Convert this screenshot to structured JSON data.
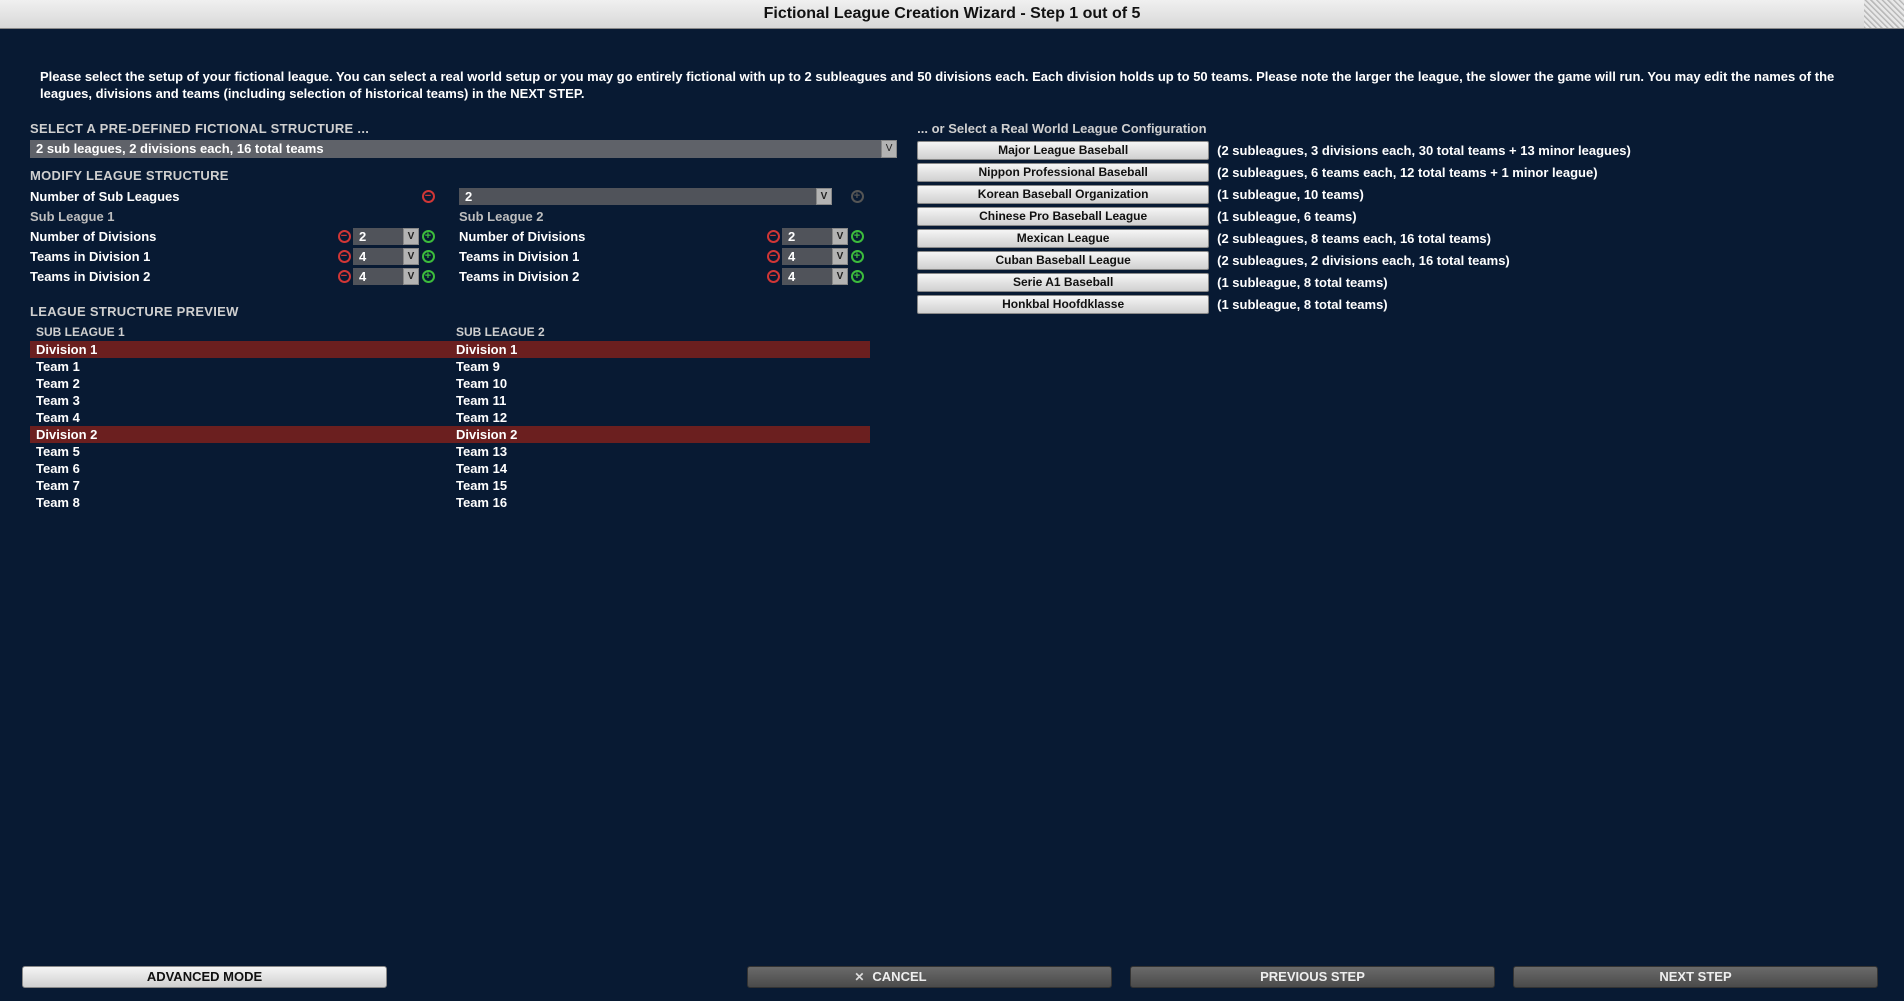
{
  "window": {
    "title": "Fictional League Creation Wizard - Step 1 out of 5"
  },
  "intro": "Please select the setup of your fictional league. You can select a real world setup or you may go entirely fictional with up to 2 subleagues and 50 divisions each. Each division holds up to 50 teams. Please note the larger the league, the slower the game will run. You may edit the names of the leagues, divisions and teams (including selection of historical teams) in the NEXT STEP.",
  "predef": {
    "header": "SELECT A PRE-DEFINED FICTIONAL STRUCTURE ...",
    "selected": "2 sub leagues, 2 divisions each, 16 total teams"
  },
  "modify": {
    "header": "MODIFY LEAGUE STRUCTURE",
    "numSubleaguesLabel": "Number of Sub Leagues",
    "numSubleagues": "2",
    "sl1": {
      "name": "Sub League 1",
      "numDivLabel": "Number of Divisions",
      "numDiv": "2",
      "td1Label": "Teams in Division 1",
      "td1": "4",
      "td2Label": "Teams in Division 2",
      "td2": "4"
    },
    "sl2": {
      "name": "Sub League 2",
      "numDivLabel": "Number of Divisions",
      "numDiv": "2",
      "td1Label": "Teams in Division 1",
      "td1": "4",
      "td2Label": "Teams in Division 2",
      "td2": "4"
    }
  },
  "preview": {
    "header": "LEAGUE STRUCTURE PREVIEW",
    "sl1": {
      "header": "SUB LEAGUE 1",
      "div1": "Division 1",
      "t": [
        "Team 1",
        "Team 2",
        "Team 3",
        "Team 4"
      ],
      "div2": "Division 2",
      "t2": [
        "Team 5",
        "Team 6",
        "Team 7",
        "Team 8"
      ]
    },
    "sl2": {
      "header": "SUB LEAGUE 2",
      "div1": "Division 1",
      "t": [
        "Team 9",
        "Team 10",
        "Team 11",
        "Team 12"
      ],
      "div2": "Division 2",
      "t2": [
        "Team 13",
        "Team 14",
        "Team 15",
        "Team 16"
      ]
    }
  },
  "realworld": {
    "header": "... or Select a Real World League Configuration",
    "items": [
      {
        "btn": "Major League Baseball",
        "desc": "(2 subleagues, 3 divisions each, 30 total teams + 13 minor leagues)"
      },
      {
        "btn": "Nippon Professional Baseball",
        "desc": "(2 subleagues, 6 teams each, 12 total teams + 1 minor league)"
      },
      {
        "btn": "Korean Baseball Organization",
        "desc": "(1 subleague, 10 teams)"
      },
      {
        "btn": "Chinese Pro Baseball League",
        "desc": "(1 subleague, 6 teams)"
      },
      {
        "btn": "Mexican League",
        "desc": "(2 subleagues, 8 teams each, 16 total teams)"
      },
      {
        "btn": "Cuban Baseball League",
        "desc": "(2 subleagues, 2 divisions each, 16 total teams)"
      },
      {
        "btn": "Serie A1 Baseball",
        "desc": "(1 subleague, 8 total teams)"
      },
      {
        "btn": "Honkbal Hoofdklasse",
        "desc": "(1 subleague, 8 total teams)"
      }
    ]
  },
  "footer": {
    "advanced": "ADVANCED MODE",
    "cancel": "CANCEL",
    "prev": "PREVIOUS STEP",
    "next": "NEXT STEP"
  }
}
